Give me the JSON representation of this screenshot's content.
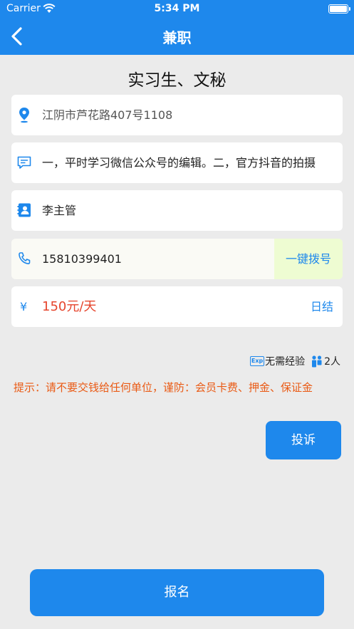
{
  "status_bar": {
    "carrier": "Carrier",
    "time": "5:34 PM"
  },
  "nav": {
    "title": "兼职"
  },
  "job": {
    "title": "实习生、文秘",
    "address": "江阴市芦花路407号1108",
    "description": "一，平时学习微信公众号的编辑。二，官方抖音的拍摄",
    "contact": "李主管",
    "phone": "15810399401",
    "dial_label": "一键拨号",
    "currency_symbol": "¥",
    "pay": "150元/天",
    "settlement": "日结",
    "exp_badge": "Exp",
    "experience": "无需经验",
    "headcount": "2人"
  },
  "warning": "提示：请不要交钱给任何单位，谨防：会员卡费、押金、保证金",
  "buttons": {
    "complain": "投诉",
    "signup": "报名"
  },
  "colors": {
    "primary": "#1e88ec",
    "pay": "#e6452d",
    "warning": "#ea5a14",
    "dial_bg": "#eefcd2",
    "background": "#ebebeb"
  }
}
